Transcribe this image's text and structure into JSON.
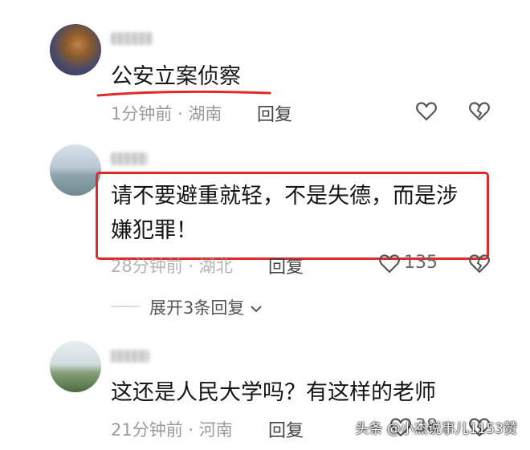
{
  "comments": [
    {
      "text": "公安立案侦察",
      "time": "1分钟前",
      "location": "湖南",
      "reply_label": "回复",
      "likes": ""
    },
    {
      "text_line1": "请不要避重就轻，不是失德，而是涉",
      "text_line2": "嫌犯罪！",
      "time": "28分钟前",
      "location": "湖北",
      "reply_label": "回复",
      "likes": "135",
      "expand_label": "展开3条回复"
    },
    {
      "text": "这还是人民大学吗？有这样的老师",
      "time": "21分钟前",
      "location": "河南",
      "reply_label": "回复",
      "likes": "38"
    }
  ],
  "separator": "·",
  "watermark": "头条 @小杰说事儿1153赞",
  "colors": {
    "highlight_red": "#e02a2a",
    "meta_gray": "#9a9a9a"
  },
  "icons": [
    "heart-outline-icon",
    "broken-heart-icon",
    "chevron-down-icon"
  ]
}
